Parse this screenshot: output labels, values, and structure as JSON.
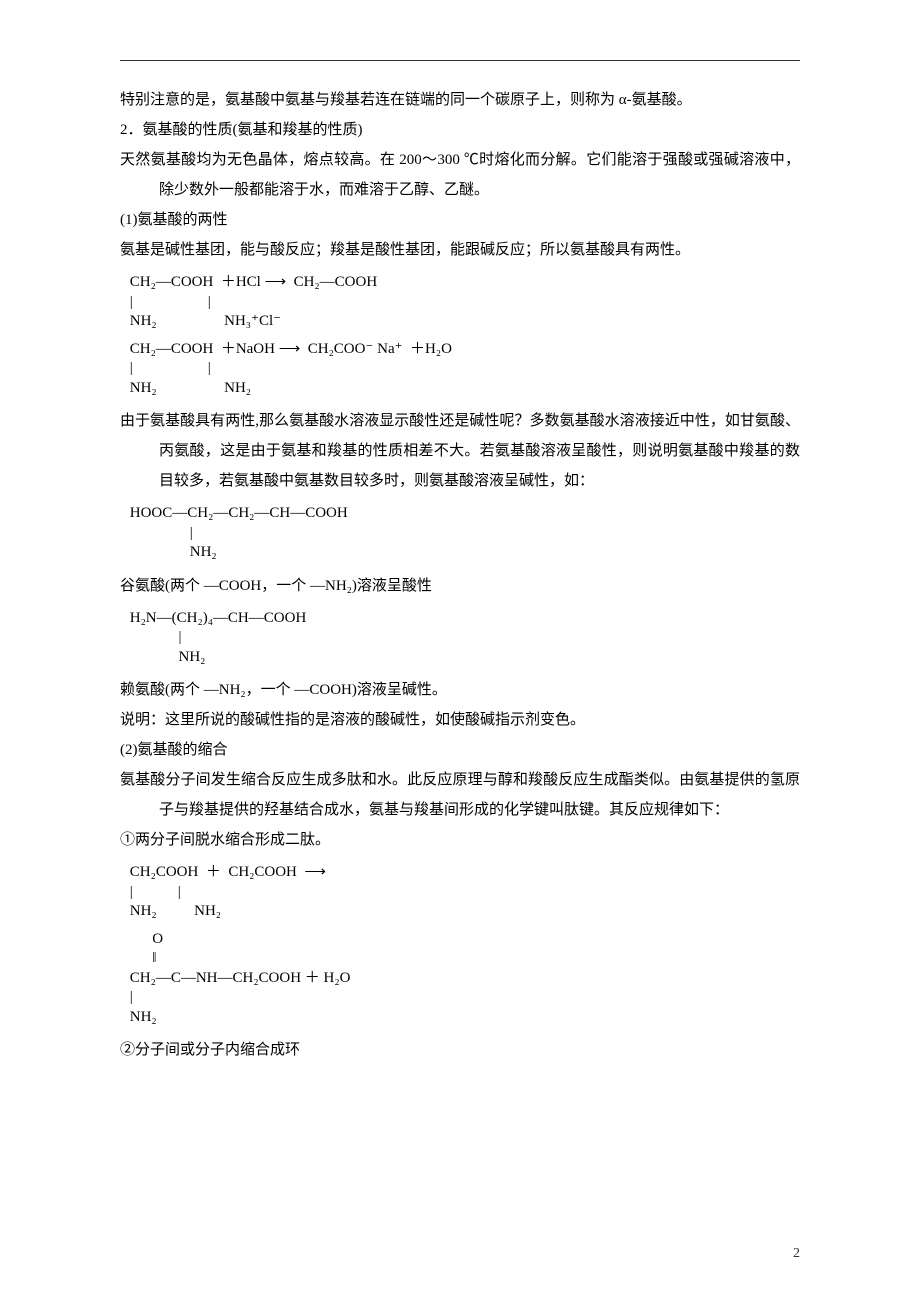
{
  "p1": "特别注意的是，氨基酸中氨基与羧基若连在链端的同一个碳原子上，则称为 α-氨基酸。",
  "p2": "2．氨基酸的性质(氨基和羧基的性质)",
  "p3": "天然氨基酸均为无色晶体，熔点较高。在 200～300 ℃时熔化而分解。它们能溶于强酸或强碱溶液中，除少数外一般都能溶于水，而难溶于乙醇、乙醚。",
  "p4": "(1)氨基酸的两性",
  "p5": "氨基是碱性基团，能与酸反应；羧基是酸性基团，能跟碱反应；所以氨基酸具有两性。",
  "f1a": " CH₂—COOH  ＋HCl ⟶  CH₂—COOH",
  "f1b": " |                    |",
  "f1c": " NH₂                  NH₃⁺Cl⁻",
  "f2a": " CH₂—COOH  ＋NaOH ⟶  CH₂COO⁻ Na⁺  ＋H₂O",
  "f2b": " |                    |",
  "f2c": " NH₂                  NH₂",
  "p6": "由于氨基酸具有两性,那么氨基酸水溶液显示酸性还是碱性呢？多数氨基酸水溶液接近中性，如甘氨酸、丙氨酸，这是由于氨基和羧基的性质相差不大。若氨基酸溶液呈酸性，则说明氨基酸中羧基的数目较多，若氨基酸中氨基数目较多时，则氨基酸溶液呈碱性，如：",
  "f3a": " HOOC—CH₂—CH₂—CH—COOH",
  "f3b": "                 |",
  "f3c": "                 NH₂",
  "p7": "谷氨酸(两个 —COOH，一个 —NH₂)溶液呈酸性",
  "f4a": " H₂N—(CH₂)₄—CH—COOH",
  "f4b": "              |",
  "f4c": "              NH₂",
  "p8": "赖氨酸(两个 —NH₂，一个 —COOH)溶液呈碱性。",
  "p9": "说明：这里所说的酸碱性指的是溶液的酸碱性，如使酸碱指示剂变色。",
  "p10": "(2)氨基酸的缩合",
  "p11": "氨基酸分子间发生缩合反应生成多肽和水。此反应原理与醇和羧酸反应生成酯类似。由氨基提供的氢原子与羧基提供的羟基结合成水，氨基与羧基间形成的化学键叫肽键。其反应规律如下：",
  "p12": "①两分子间脱水缩合形成二肽。",
  "f5a": " CH₂COOH  ＋  CH₂COOH  ⟶",
  "f5b": " |            |",
  "f5c": " NH₂          NH₂",
  "f6a": "       O",
  "f6b": "       ‖",
  "f6c": " CH₂—C—NH—CH₂COOH ＋ H₂O",
  "f6d": " |",
  "f6e": " NH₂",
  "p13": "②分子间或分子内缩合成环",
  "page_number": "2"
}
